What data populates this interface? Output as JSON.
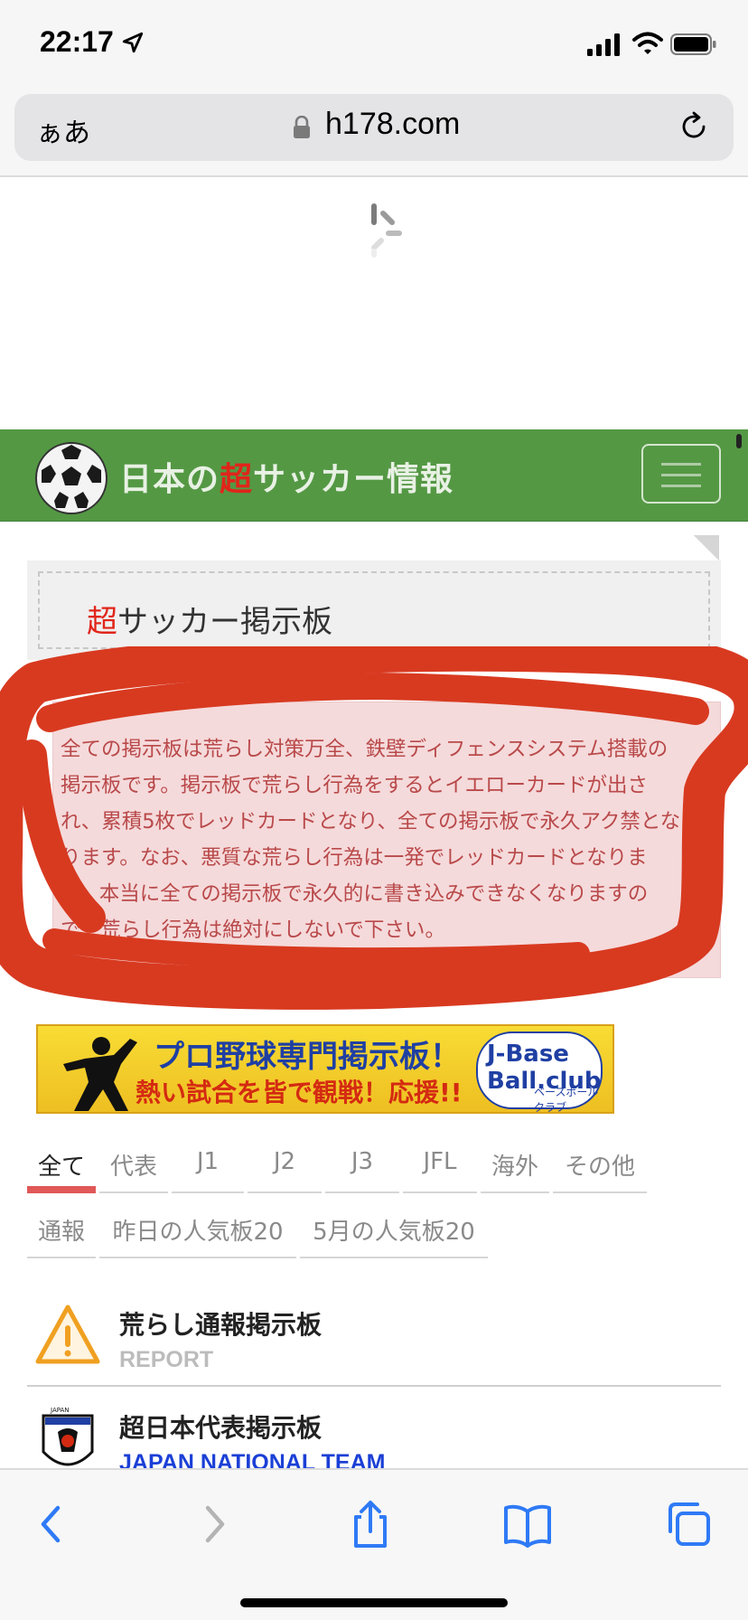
{
  "status_bar": {
    "time": "22:17"
  },
  "address_bar": {
    "aa_label": "ぁあ",
    "url": "h178.com"
  },
  "site": {
    "title_prefix": "日本の",
    "title_accent": "超",
    "title_suffix": "サッカー情報"
  },
  "board": {
    "title_accent": "超",
    "title_rest": "サッカー掲示板",
    "notice": "全ての掲示板は荒らし対策万全、鉄壁ディフェンスシステム搭載の掲示板です。掲示板で荒らし行為をするとイエローカードが出され、累積5枚でレッドカードとなり、全ての掲示板で永久アク禁となります。なお、悪質な荒らし行為は一発でレッドカードとなります。本当に全ての掲示板で永久的に書き込みできなくなりますので、荒らし行為は絶対にしないで下さい。"
  },
  "banner": {
    "line1": "プロ野球専門掲示板！",
    "line2": "熱い試合を皆で観戦！応援!!",
    "logo_text": "J-Base Ball.club",
    "logo_sub": "ベースボールクラブ"
  },
  "tabs": [
    {
      "label": "全て",
      "active": true
    },
    {
      "label": "代表"
    },
    {
      "label": "J1"
    },
    {
      "label": "J2"
    },
    {
      "label": "J3"
    },
    {
      "label": "JFL"
    },
    {
      "label": "海外"
    },
    {
      "label": "その他"
    },
    {
      "label": "通報"
    },
    {
      "label": "昨日の人気板20"
    },
    {
      "label": "5月の人気板20"
    }
  ],
  "list": [
    {
      "title": "荒らし通報掲示板",
      "subtitle": "REPORT",
      "icon": "warning-icon"
    },
    {
      "title": "超日本代表掲示板",
      "subtitle": "JAPAN NATIONAL TEAM",
      "icon": "jfa-emblem-icon",
      "subtitle_color": "#1b3fd6"
    }
  ],
  "colors": {
    "header_green": "#549844",
    "accent_red": "#e0251a",
    "annotation_red": "#d83a20",
    "notice_text": "#b9494a"
  }
}
